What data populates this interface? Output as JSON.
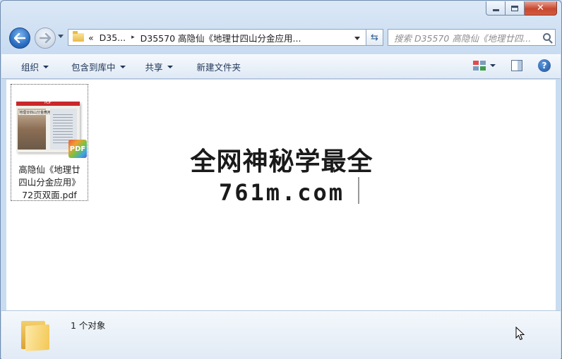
{
  "window": {
    "controls": {
      "minimize": "minimize",
      "maximize": "maximize",
      "close": "✕"
    }
  },
  "address_bar": {
    "overflow": "«",
    "crumbs": [
      "D35...",
      "D35570 高隐仙《地理廿四山分金应用..."
    ],
    "separator": "▸"
  },
  "search": {
    "placeholder": "搜索 D35570 高隐仙《地理廿四..."
  },
  "toolbar": {
    "organize": "组织",
    "include_in_library": "包含到库中",
    "share": "共享",
    "new_folder": "新建文件夹",
    "help": "?"
  },
  "file": {
    "name_line1": "高隐仙《地理廿",
    "name_line2": "四山分金应用》",
    "name_line3": "72页双面.pdf",
    "badge": "PDF",
    "thumb_band": "PDF",
    "thumb_title": "地理廿四山分金應用"
  },
  "watermark": {
    "line1": "全网神秘学最全",
    "line2": "761m.com"
  },
  "details": {
    "count": "1 个对象"
  },
  "colors": {
    "accent": "#2b6fc4",
    "close": "#c8472e",
    "pdf_red": "#c9272b"
  }
}
